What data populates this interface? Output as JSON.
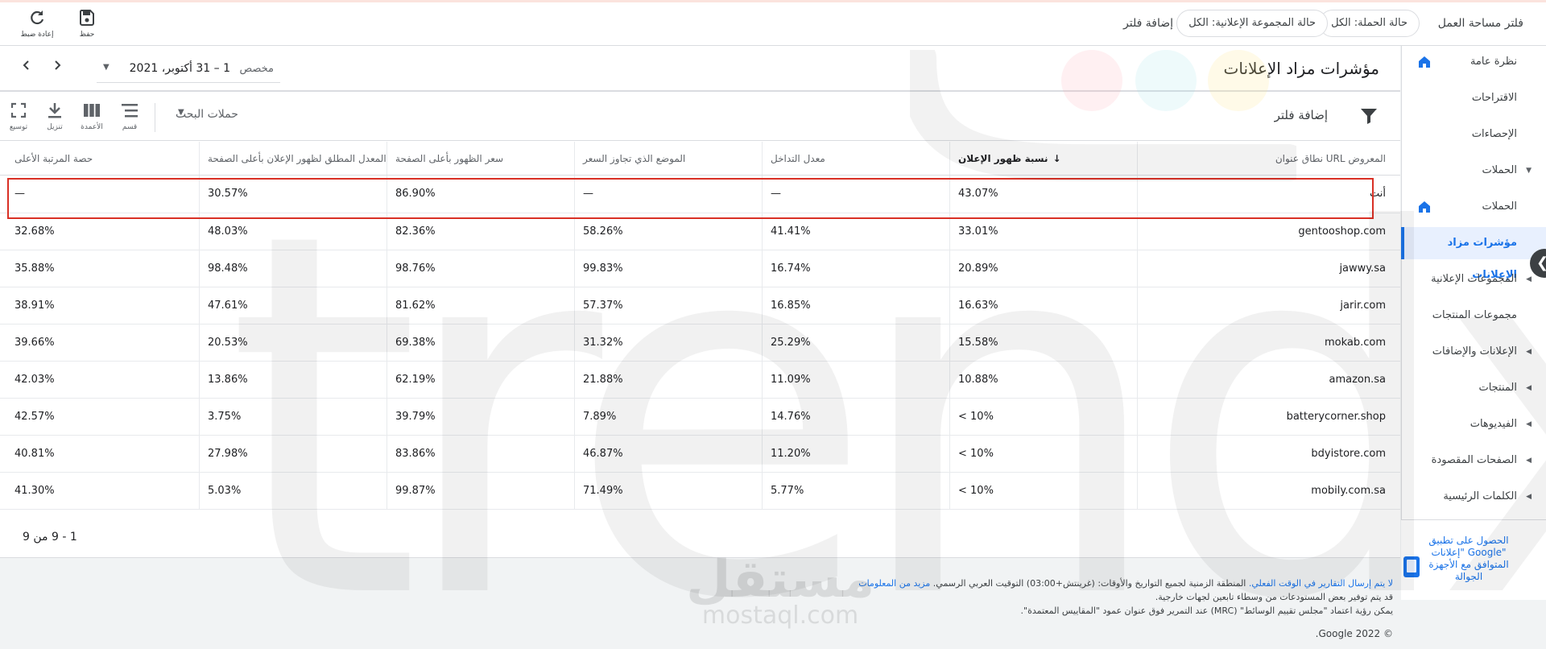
{
  "filter_bar": {
    "title": "فلتر مساحة العمل",
    "chip_campaign_status": "حالة الحملة: الكل",
    "chip_adgroup_status": "حالة المجموعة الإعلانية: الكل",
    "add_filter": "إضافة فلتر",
    "save_label": "حفظ",
    "reset_label": "إعادة ضبط"
  },
  "nav": {
    "items": [
      {
        "label": "نظرة عامة",
        "home": true
      },
      {
        "label": "الاقتراحات"
      },
      {
        "label": "الإحصاءات"
      },
      {
        "label": "الحملات",
        "caret": "▼"
      },
      {
        "label": "الحملات",
        "home": true
      },
      {
        "label": "مؤشرات مزاد الإعلانات",
        "active": true
      },
      {
        "label": "المجموعات الإعلانية",
        "caret": "◀"
      },
      {
        "label": "مجموعات المنتجات"
      },
      {
        "label": "الإعلانات والإضافات",
        "caret": "◀"
      },
      {
        "label": "المنتجات",
        "caret": "◀"
      },
      {
        "label": "الفيديوهات",
        "caret": "◀"
      },
      {
        "label": "الصفحات المقصودة",
        "caret": "◀"
      },
      {
        "label": "الكلمات الرئيسية",
        "caret": "◀"
      }
    ],
    "app_promo": "الحصول على تطبيق \"إعلانات Google\" المتوافق مع الأجهزة الجوالة"
  },
  "header": {
    "title": "مؤشرات مزاد الإعلانات",
    "date_label": "مخصص",
    "date_value": "1 – 31 أكتوبر، 2021"
  },
  "table_toolbar": {
    "add_filter": "إضافة فلتر",
    "search_campaigns": "حملات البحث",
    "segment": "قسم",
    "columns": "الأعمدة",
    "download": "تنزيل",
    "expand": "توسيع"
  },
  "table": {
    "columns": [
      "نطاق عنوان URL المعروض",
      "نسبة ظهور الإعلان",
      "معدل التداخل",
      "الموضع الذي تجاوز السعر",
      "سعر الظهور بأعلى الصفحة",
      "المعدل المطلق لظهور الإعلان بأعلى الصفحة",
      "حصة المرتبة الأعلى"
    ],
    "rows": [
      [
        "أنت",
        "43.07%",
        "—",
        "—",
        "86.90%",
        "30.57%",
        "—"
      ],
      [
        "gentooshop.com",
        "33.01%",
        "41.41%",
        "58.26%",
        "82.36%",
        "48.03%",
        "32.68%"
      ],
      [
        "jawwy.sa",
        "20.89%",
        "16.74%",
        "99.83%",
        "98.76%",
        "98.48%",
        "35.88%"
      ],
      [
        "jarir.com",
        "16.63%",
        "16.85%",
        "57.37%",
        "81.62%",
        "47.61%",
        "38.91%"
      ],
      [
        "mokab.com",
        "15.58%",
        "25.29%",
        "31.32%",
        "69.38%",
        "20.53%",
        "39.66%"
      ],
      [
        "amazon.sa",
        "10.88%",
        "11.09%",
        "21.88%",
        "62.19%",
        "13.86%",
        "42.03%"
      ],
      [
        "batterycorner.shop",
        "< 10%",
        "14.76%",
        "7.89%",
        "39.79%",
        "3.75%",
        "42.57%"
      ],
      [
        "bdyistore.com",
        "< 10%",
        "11.20%",
        "46.87%",
        "83.86%",
        "27.98%",
        "40.81%"
      ],
      [
        "mobily.com.sa",
        "< 10%",
        "5.77%",
        "71.49%",
        "99.87%",
        "5.03%",
        "41.30%"
      ]
    ],
    "pagination": "1 - 9 من 9"
  },
  "footer": {
    "line1_link": "لا يتم إرسال التقارير في الوقت الفعلي.",
    "line1_text": " المنطقة الزمنية لجميع التواريخ والأوقات: (غرينتش+03:00) التوقيت العربي الرسمي. ",
    "line1_more": "مزيد من المعلومات",
    "line2": "قد يتم توفير بعض المستودعات من وسطاء تابعين لجهات خارجية.",
    "line3": "يمكن رؤية اعتماد \"مجلس تقييم الوسائط\" (MRC) عند التمرير فوق عنوان عمود \"المقاييس المعتمدة\".",
    "copyright": "© 2022 Google."
  },
  "watermark": {
    "brand": "trendx",
    "mostaql_ar": "مستقل",
    "mostaql_en": "mostaql.com"
  },
  "colors": {
    "accent": "#1a73e8",
    "highlight_border": "#d93025"
  }
}
